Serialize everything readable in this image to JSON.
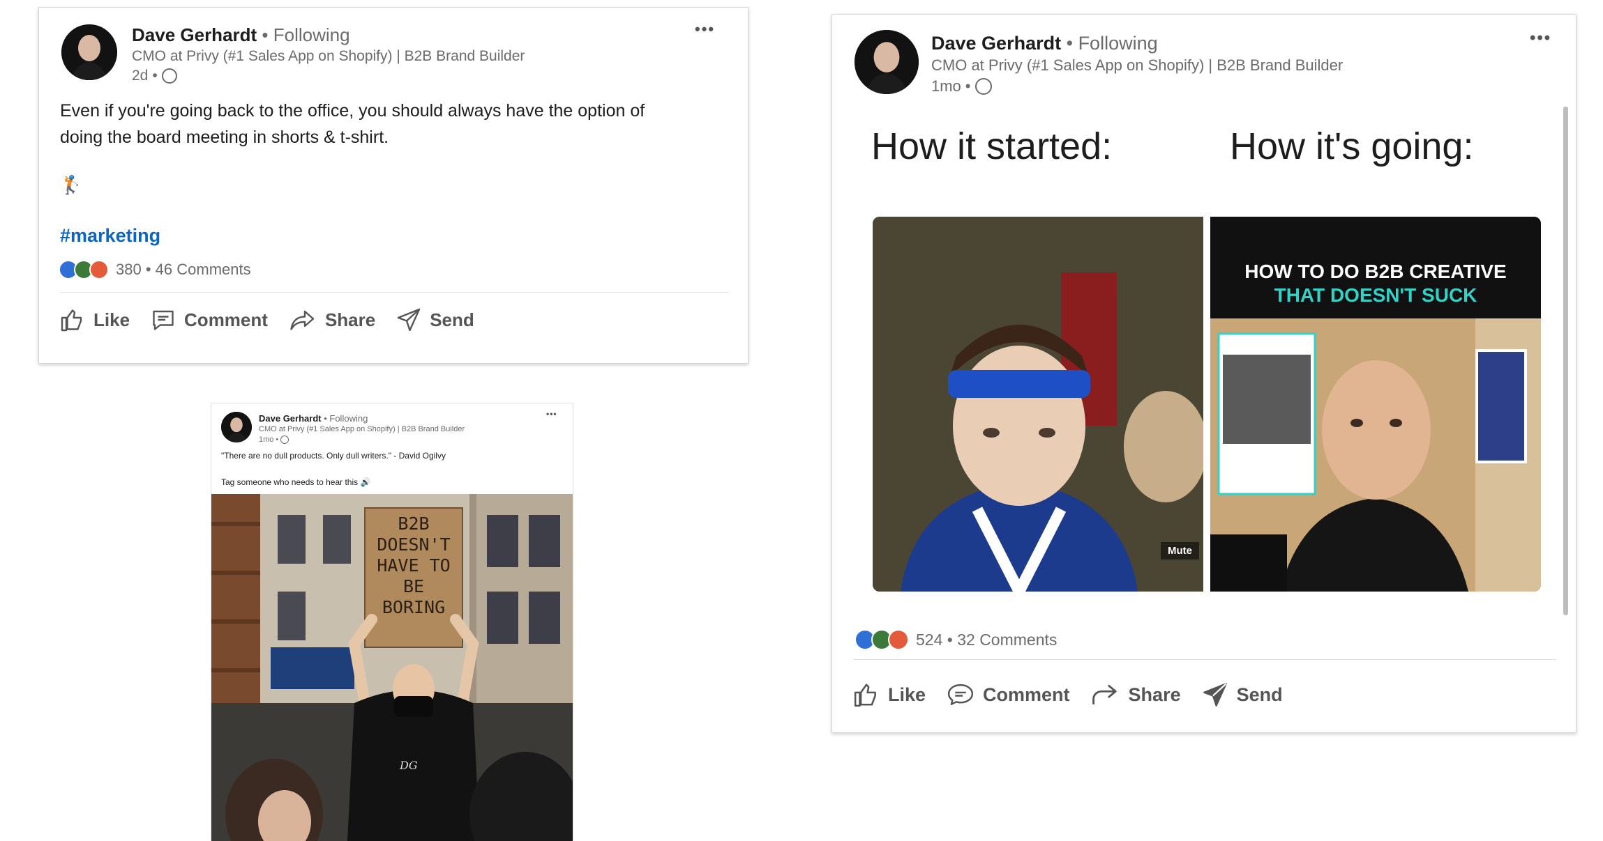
{
  "author": {
    "name": "Dave Gerhardt",
    "following": "Following",
    "headline": "CMO at Privy (#1 Sales App on Shopify) | B2B Brand Builder"
  },
  "post1": {
    "time": "2d",
    "text_line1": "Even if you're going back to the office, you should always have the option of",
    "text_line2": "doing the board meeting in shorts & t-shirt.",
    "emoji": "🏌",
    "hashtag": "#marketing",
    "reaction_count": "380",
    "comments": "46 Comments",
    "more_label": "•••"
  },
  "post2": {
    "time": "1mo",
    "text_line1": "\"There are no dull products. Only dull writers.\" - David Ogilvy",
    "text_line2": "Tag someone who needs to hear this 🔊",
    "more_label": "•••",
    "sign_lines": [
      "B2B",
      "DOESN'T",
      "HAVE TO",
      "BE",
      "BORING"
    ],
    "shirt_logo": "DG"
  },
  "post3": {
    "time": "1mo",
    "meme_left_title": "How it started:",
    "meme_right_title": "How it's going:",
    "mute_label": "Mute",
    "video_title_line1": "HOW TO DO B2B CREATIVE",
    "video_title_line2": "THAT DOESN'T SUCK",
    "reaction_count": "524",
    "comments": "32 Comments",
    "more_label": "•••"
  },
  "actions": {
    "like": "Like",
    "comment": "Comment",
    "share": "Share",
    "send": "Send"
  },
  "colors": {
    "link_blue": "#0a66c2",
    "muted_text": "#6b6b6b",
    "video_title_white": "#ffffff",
    "video_title_cyan": "#33d1c6"
  }
}
